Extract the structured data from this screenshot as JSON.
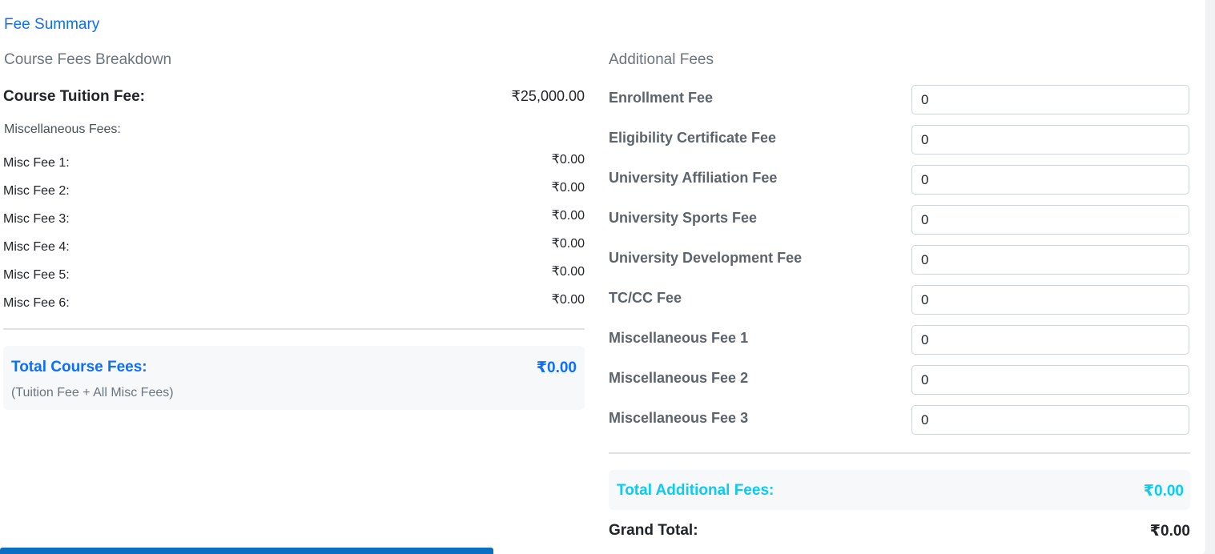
{
  "title": "Fee Summary",
  "course": {
    "heading": "Course Fees Breakdown",
    "tuition_label": "Course Tuition Fee:",
    "tuition_value": "₹25,000.00",
    "misc_heading": "Miscellaneous Fees:",
    "misc": [
      {
        "label": "Misc Fee 1:",
        "value": "₹0.00"
      },
      {
        "label": "Misc Fee 2:",
        "value": "₹0.00"
      },
      {
        "label": "Misc Fee 3:",
        "value": "₹0.00"
      },
      {
        "label": "Misc Fee 4:",
        "value": "₹0.00"
      },
      {
        "label": "Misc Fee 5:",
        "value": "₹0.00"
      },
      {
        "label": "Misc Fee 6:",
        "value": "₹0.00"
      }
    ],
    "total_label": "Total Course Fees:",
    "total_value": "₹0.00",
    "total_note": "(Tuition Fee + All Misc Fees)"
  },
  "additional": {
    "heading": "Additional Fees",
    "fees": [
      {
        "label": "Enrollment Fee",
        "value": "0"
      },
      {
        "label": "Eligibility Certificate Fee",
        "value": "0"
      },
      {
        "label": "University Affiliation Fee",
        "value": "0"
      },
      {
        "label": "University Sports Fee",
        "value": "0"
      },
      {
        "label": "University Development Fee",
        "value": "0"
      },
      {
        "label": "TC/CC Fee",
        "value": "0"
      },
      {
        "label": "Miscellaneous Fee 1",
        "value": "0"
      },
      {
        "label": "Miscellaneous Fee 2",
        "value": "0"
      },
      {
        "label": "Miscellaneous Fee 3",
        "value": "0"
      }
    ],
    "total_label": "Total Additional Fees:",
    "total_value": "₹0.00"
  },
  "grand_total_label": "Grand Total:",
  "grand_total_value": "₹0.00",
  "colors": {
    "primary": "#0d6efd",
    "info": "#0dcaf0",
    "muted": "#6c757d"
  }
}
